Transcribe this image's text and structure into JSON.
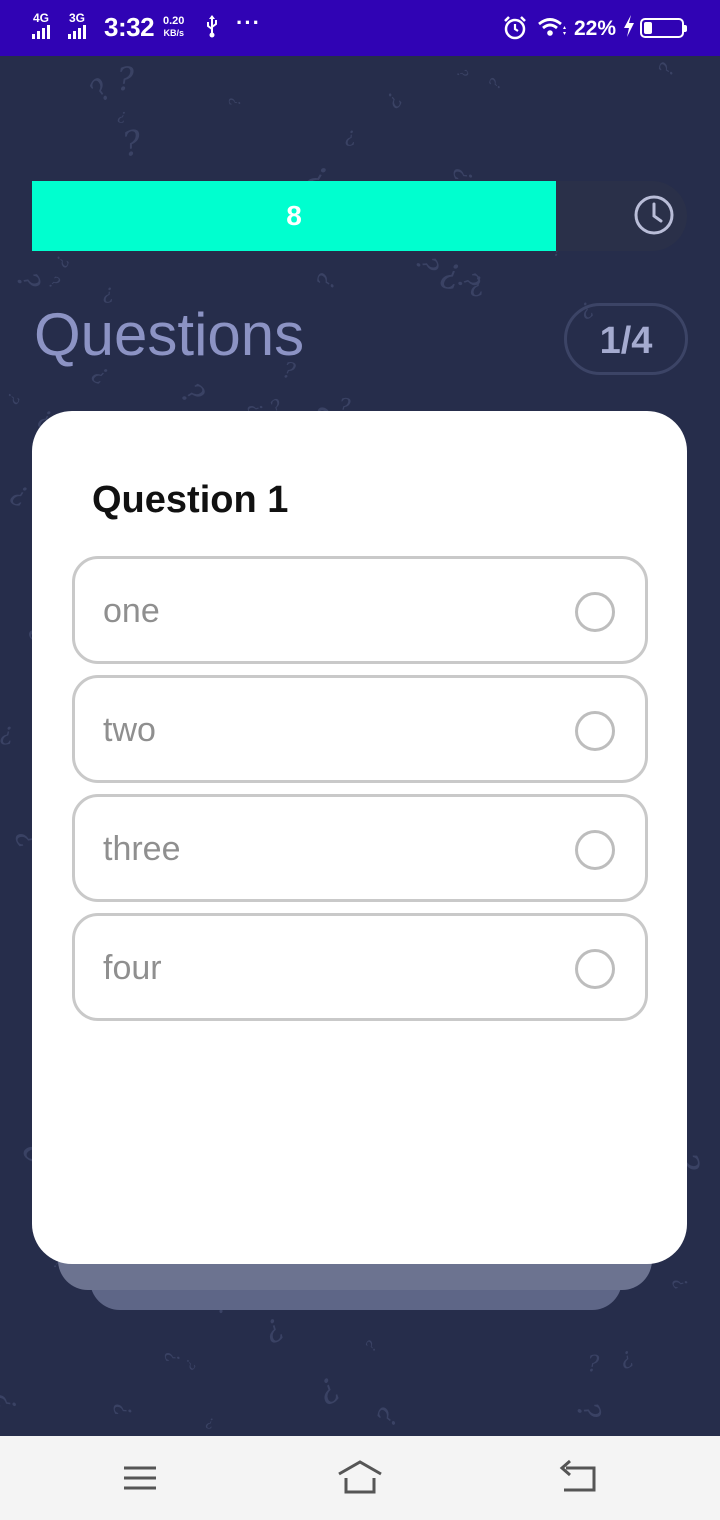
{
  "status_bar": {
    "network1": "4G",
    "network2": "3G",
    "time": "3:32",
    "speed_value": "0.20",
    "speed_unit": "KB/s",
    "dots": "···",
    "battery_percent": "22%",
    "battery_level": 0.22
  },
  "timer": {
    "value": "8",
    "progress": 0.8
  },
  "header": {
    "title": "Questions",
    "counter": "1/4"
  },
  "question": {
    "title": "Question 1",
    "options": [
      {
        "label": "one"
      },
      {
        "label": "two"
      },
      {
        "label": "three"
      },
      {
        "label": "four"
      }
    ]
  },
  "colors": {
    "status_bar": "#3003b4",
    "background": "#262d4b",
    "timer_fill": "#00ffcf",
    "card": "#ffffff"
  },
  "icons": {
    "clock": "clock-icon",
    "radio": "radio-button-icon",
    "menu": "menu-icon",
    "home": "home-icon",
    "back": "back-icon"
  }
}
